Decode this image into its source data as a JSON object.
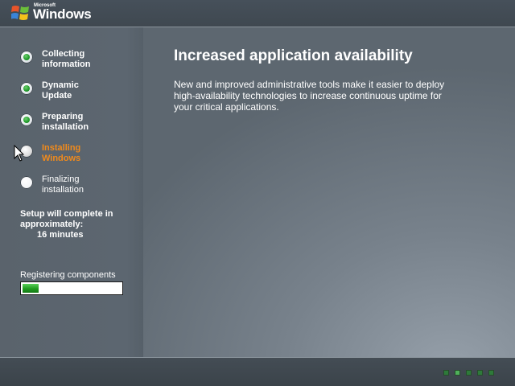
{
  "header": {
    "logo_small": "Microsoft",
    "logo_word": "Windows"
  },
  "steps": [
    {
      "label": "Collecting\ninformation",
      "state": "done"
    },
    {
      "label": "Dynamic\nUpdate",
      "state": "done"
    },
    {
      "label": "Preparing\ninstallation",
      "state": "done"
    },
    {
      "label": "Installing\nWindows",
      "state": "current"
    },
    {
      "label": "Finalizing\ninstallation",
      "state": "pending"
    }
  ],
  "estimate": {
    "text": "Setup will complete in approximately:",
    "time": "16 minutes"
  },
  "progress": {
    "label": "Registering components",
    "fraction": 0.16
  },
  "feature": {
    "title": "Increased application availability",
    "body": "New and improved administrative tools make it easier to deploy high-availability technologies to increase continuous uptime for your critical applications."
  },
  "pager": {
    "count": 5,
    "active_index": 1
  },
  "colors": {
    "current_step": "#f08a1c",
    "progress_fill": "#1f9b1f"
  }
}
